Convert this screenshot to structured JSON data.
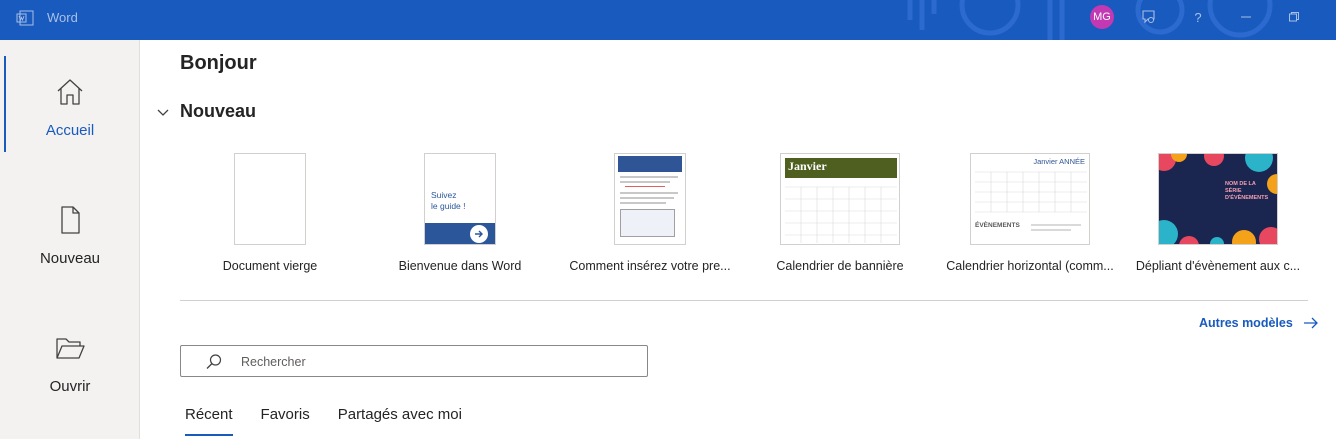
{
  "titlebar": {
    "app_name": "Word",
    "avatar_initials": "MG",
    "accent_color": "#185abd"
  },
  "nav": {
    "items": [
      {
        "label": "Accueil",
        "icon": "home-icon",
        "active": true
      },
      {
        "label": "Nouveau",
        "icon": "new-document-icon",
        "active": false
      },
      {
        "label": "Ouvrir",
        "icon": "folder-open-icon",
        "active": false
      }
    ]
  },
  "main": {
    "greeting": "Bonjour",
    "new_section": {
      "title": "Nouveau",
      "templates": [
        {
          "label": "Document vierge"
        },
        {
          "label": "Bienvenue dans Word",
          "thumb_text": [
            "Suivez",
            "le guide !"
          ]
        },
        {
          "label": "Comment insérez votre pre..."
        },
        {
          "label": "Calendrier de bannière",
          "thumb_text": "Janvier"
        },
        {
          "label": "Calendrier horizontal (comm...",
          "thumb_text": "Janvier ANNÉE",
          "thumb_subtext": "ÉVÈNEMENTS"
        },
        {
          "label": "Dépliant d'évènement aux c...",
          "thumb_text": [
            "NOM DE LA",
            "SÉRIE",
            "D'ÉVÈNEMENTS"
          ]
        }
      ],
      "more_templates": "Autres modèles"
    },
    "search": {
      "placeholder": "Rechercher",
      "value": ""
    },
    "tabs": [
      {
        "label": "Récent",
        "active": true
      },
      {
        "label": "Favoris",
        "active": false
      },
      {
        "label": "Partagés avec moi",
        "active": false
      }
    ]
  }
}
